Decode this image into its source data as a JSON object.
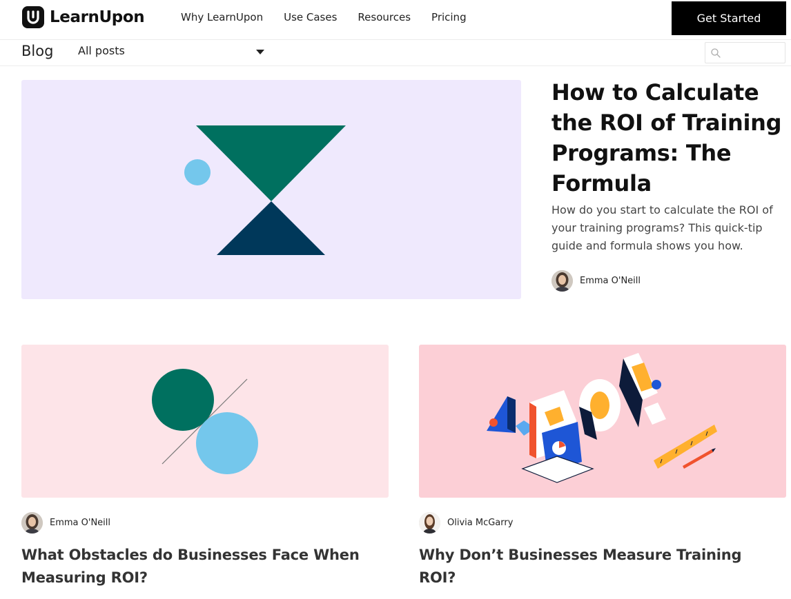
{
  "brand": {
    "name": "LearnUpon"
  },
  "nav": {
    "items": [
      "Why LearnUpon",
      "Use Cases",
      "Resources",
      "Pricing"
    ],
    "cta": "Get Started"
  },
  "blog_bar": {
    "title": "Blog",
    "filter": "All posts",
    "search_placeholder": ""
  },
  "featured": {
    "title": "How to Calculate the ROI of Training Programs: The Formula",
    "description": "How do you start to calculate the ROI of your training programs? This quick-tip guide and formula shows you how.",
    "author": "Emma O'Neill"
  },
  "cards": [
    {
      "author": "Emma O'Neill",
      "title": "What Obstacles do Businesses Face When Measuring ROI?"
    },
    {
      "author": "Olivia McGarry",
      "title": "Why Don’t Businesses Measure Training ROI?"
    }
  ],
  "colors": {
    "accent_green": "#00705f",
    "accent_navy": "#00385a",
    "accent_light_blue": "#74c7ec",
    "featured_bg": "#efe9fd",
    "card1_bg": "#fde4e8",
    "card2_bg": "#fccfd6",
    "cta_bg": "#000000"
  },
  "icons": {
    "logo": "learnupon-logo-icon",
    "search": "search-icon",
    "filter_caret": "chevron-down-icon"
  }
}
